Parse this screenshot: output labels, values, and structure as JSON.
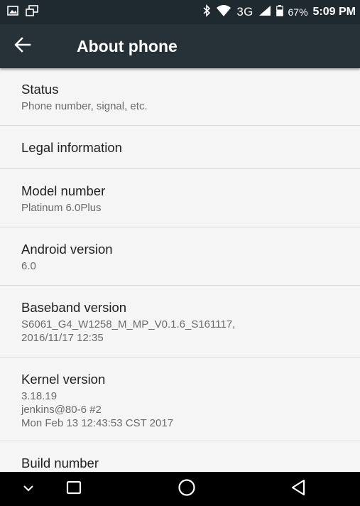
{
  "status_bar": {
    "network": "3G",
    "battery_percent": "67%",
    "time": "5:09 PM",
    "icons": [
      "gallery-icon",
      "cast-icon",
      "bluetooth-icon",
      "wifi-icon",
      "signal-icon",
      "battery-icon"
    ]
  },
  "app_bar": {
    "title": "About phone",
    "back_icon": "arrow-back-icon"
  },
  "items": [
    {
      "title": "Status",
      "subtitle": [
        "Phone number, signal, etc."
      ]
    },
    {
      "title": "Legal information",
      "subtitle": []
    },
    {
      "title": "Model number",
      "subtitle": [
        "Platinum 6.0Plus"
      ]
    },
    {
      "title": "Android version",
      "subtitle": [
        "6.0"
      ]
    },
    {
      "title": "Baseband version",
      "subtitle": [
        "S6061_G4_W1258_M_MP_V0.1.6_S161117,",
        "2016/11/17 12:35"
      ]
    },
    {
      "title": "Kernel version",
      "subtitle": [
        "3.18.19",
        "jenkins@80-6 #2",
        "Mon Feb 13 12:43:53 CST 2017"
      ]
    },
    {
      "title": "Build number",
      "subtitle": []
    }
  ],
  "nav_bar": {
    "icons": [
      "hide-keyboard-icon",
      "recent-apps-icon",
      "home-icon",
      "back-icon"
    ]
  },
  "colors": {
    "status_bar": "#1f2a30",
    "app_bar": "#263238",
    "background": "#f5f5f5",
    "divider": "#d9d9d9",
    "nav_bar": "#000000"
  }
}
